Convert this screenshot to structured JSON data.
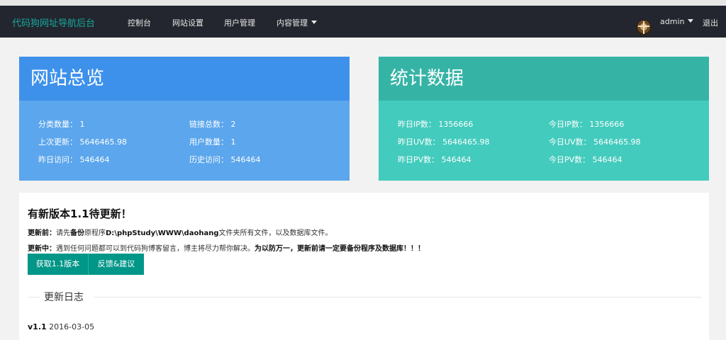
{
  "navbar": {
    "brand": "代码狗网址导航后台",
    "items": [
      "控制台",
      "网站设置",
      "用户管理",
      "内容管理"
    ],
    "user": "admin",
    "logout": "退出"
  },
  "overview": {
    "title": "网站总览",
    "stats": [
      "分类数量： 1",
      "链接总数： 2",
      "上次更新： 5646465.98",
      "用户数量： 1",
      "昨日访问： 546464",
      "历史访问： 546464"
    ]
  },
  "statistics": {
    "title": "统计数据",
    "stats": [
      "昨日IP数： 1356666",
      "今日IP数： 1356666",
      "昨日UV数： 5646465.98",
      "今日UV数： 5646465.98",
      "昨日PV数： 546464",
      "今日PV数： 546464"
    ]
  },
  "update": {
    "title": "有新版本1.1待更新！",
    "before_label": "更新前：",
    "before_text_1": "请先",
    "before_bold_1": "备份",
    "before_text_2": "原程序",
    "before_bold_2": "D:\\phpStudy\\WWW\\daohang",
    "before_text_3": "文件夹所有文件，以及数据库文件。",
    "during_label": "更新中：",
    "during_text": "遇到任何问题都可以到代码狗博客留言，博主将尽力帮你解决。",
    "during_bold": "为以防万一，更新前请一定要备份程序及数据库！！！",
    "btn_get": "获取1.1版本",
    "btn_feedback": "反馈&建议"
  },
  "changelog": {
    "legend": "更新日志",
    "version": "v1.1",
    "date": "2016-03-05"
  },
  "colors": {
    "navbar": "#23262e",
    "brand": "#15a89c",
    "blue_header": "#3d91ea",
    "blue_body": "#5ba6ec",
    "green_header": "#35b4a6",
    "green_body": "#43cbbd",
    "button": "#009688"
  }
}
